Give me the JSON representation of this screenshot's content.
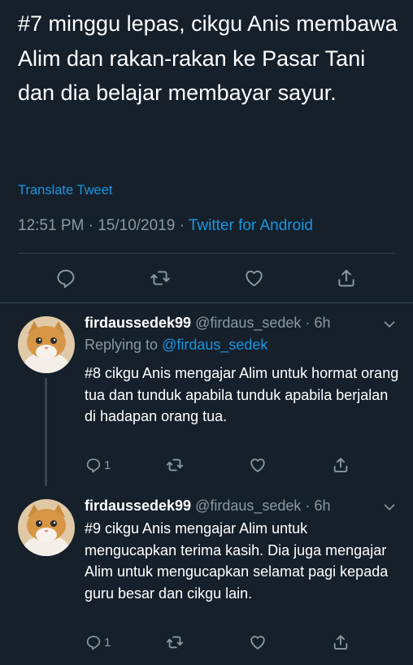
{
  "tweet": {
    "text": "#7 minggu lepas, cikgu Anis membawa Alim dan rakan-rakan ke Pasar Tani dan dia belajar membayar sayur.",
    "translate_label": "Translate Tweet",
    "time": "12:51 PM",
    "separator": "·",
    "date": "15/10/2019",
    "source": "Twitter for Android"
  },
  "actions": [
    {
      "name": "reply",
      "icon": "reply-icon"
    },
    {
      "name": "retweet",
      "icon": "retweet-icon"
    },
    {
      "name": "like",
      "icon": "heart-icon"
    },
    {
      "name": "share",
      "icon": "share-icon"
    }
  ],
  "replies": [
    {
      "display_name": "firdaussedek99",
      "handle": "@firdaus_sedek",
      "age": "· 6h",
      "replying_label": "Replying to",
      "replying_to": "@firdaus_sedek",
      "text": "#8 cikgu Anis mengajar Alim untuk hormat orang tua dan tunduk apabila tunduk apabila berjalan di hadapan orang tua.",
      "reply_count": "1"
    },
    {
      "display_name": "firdaussedek99",
      "handle": "@firdaus_sedek",
      "age": "· 6h",
      "text": "#9 cikgu Anis mengajar Alim untuk mengucapkan terima kasih. Dia juga mengajar Alim untuk mengucapkan selamat pagi kepada guru besar dan cikgu lain.",
      "reply_count": "1"
    }
  ],
  "colors": {
    "background": "#15202b",
    "accent": "#1b95e0",
    "secondary_text": "#8899a6",
    "divider": "#38444d"
  }
}
